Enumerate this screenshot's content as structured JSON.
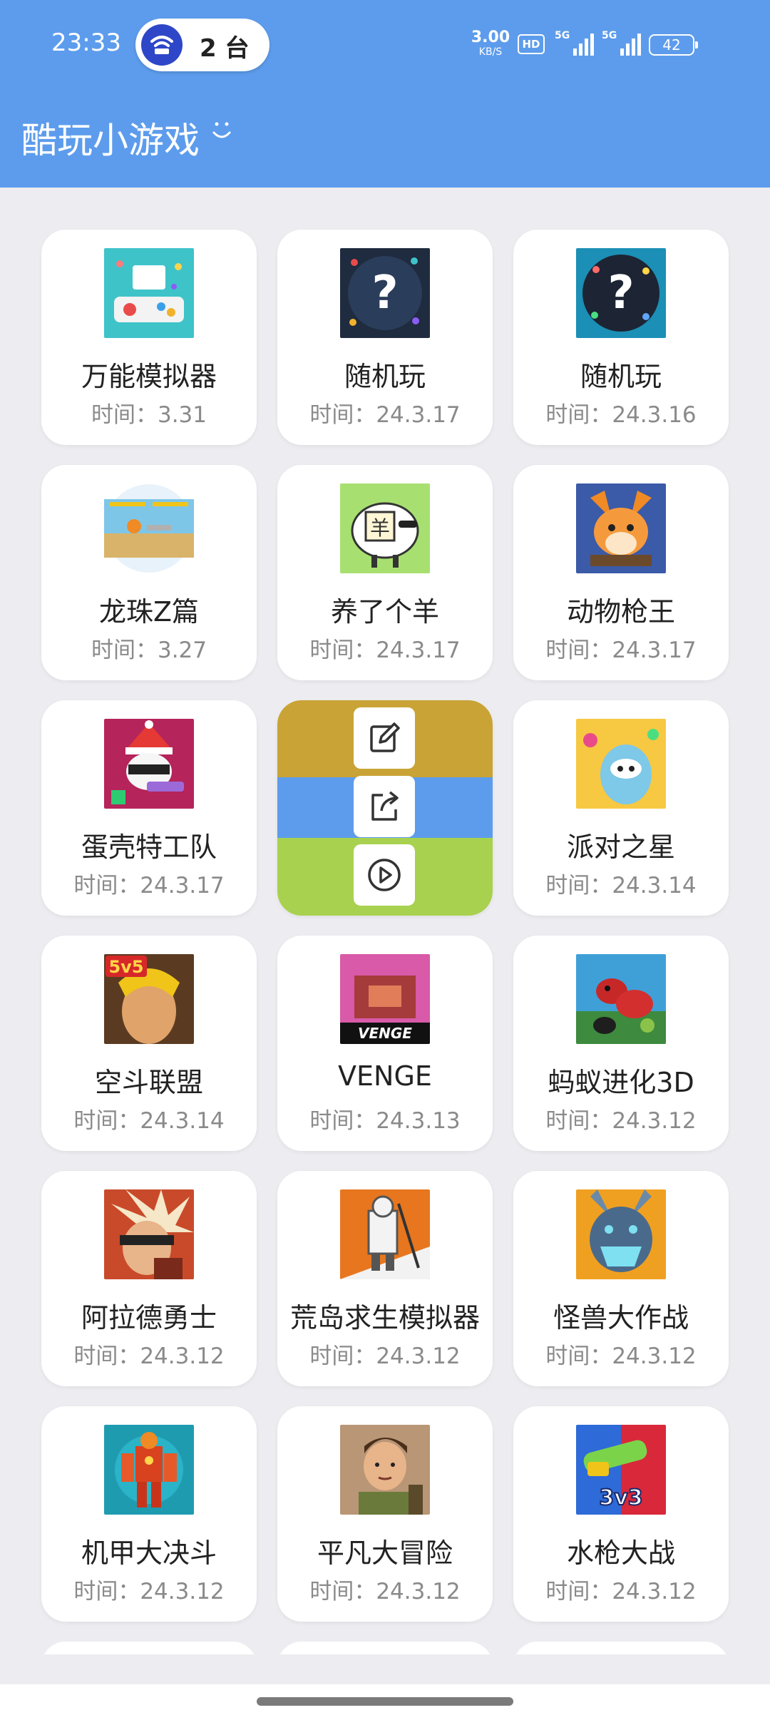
{
  "status_bar": {
    "time": "23:33",
    "hotspot_count": "2 台",
    "net_speed_value": "3.00",
    "net_speed_unit": "KB/S",
    "hd_label": "HD",
    "signal1_label": "5G",
    "signal2_label": "5G",
    "battery": "42"
  },
  "header": {
    "title": "酷玩小游戏",
    "accent_color": "#5d9cec"
  },
  "games": [
    {
      "name": "万能模拟器",
      "time_label": "时间：",
      "time": "3.31",
      "icon": "emulator-icon"
    },
    {
      "name": "随机玩",
      "time_label": "时间：",
      "time": "24.3.17",
      "icon": "random-play-icon"
    },
    {
      "name": "随机玩",
      "time_label": "时间：",
      "time": "24.3.16",
      "icon": "random-play-icon"
    },
    {
      "name": "龙珠Z篇",
      "time_label": "时间：",
      "time": "3.27",
      "icon": "dragon-ball-icon"
    },
    {
      "name": "养了个羊",
      "time_label": "时间：",
      "time": "24.3.17",
      "icon": "sheep-icon"
    },
    {
      "name": "动物枪王",
      "time_label": "时间：",
      "time": "24.3.17",
      "icon": "fox-gunner-icon"
    },
    {
      "name": "蛋壳特工队",
      "time_label": "时间：",
      "time": "24.3.17",
      "icon": "agent-icon"
    },
    {
      "name": "派对之星",
      "time_label": "时间：",
      "time": "24.3.14",
      "icon": "party-star-icon"
    },
    {
      "name": "空斗联盟",
      "time_label": "时间：",
      "time": "24.3.14",
      "icon": "5v5-icon"
    },
    {
      "name": "VENGE",
      "time_label": "时间：",
      "time": "24.3.13",
      "icon": "venge-icon"
    },
    {
      "name": "蚂蚁进化3D",
      "time_label": "时间：",
      "time": "24.3.12",
      "icon": "ant-icon"
    },
    {
      "name": "阿拉德勇士",
      "time_label": "时间：",
      "time": "24.3.12",
      "icon": "warrior-icon"
    },
    {
      "name": "荒岛求生模拟器",
      "time_label": "时间：",
      "time": "24.3.12",
      "icon": "survival-icon"
    },
    {
      "name": "怪兽大作战",
      "time_label": "时间：",
      "time": "24.3.12",
      "icon": "monster-icon"
    },
    {
      "name": "机甲大决斗",
      "time_label": "时间：",
      "time": "24.3.12",
      "icon": "mecha-icon"
    },
    {
      "name": "平凡大冒险",
      "time_label": "时间：",
      "time": "24.3.12",
      "icon": "adventure-icon"
    },
    {
      "name": "水枪大战",
      "time_label": "时间：",
      "time": "24.3.12",
      "icon": "water-gun-icon"
    }
  ],
  "action_card": {
    "colors": [
      "#c9a335",
      "#5d9cec",
      "#a8d14f"
    ],
    "actions": [
      "edit-icon",
      "share-icon",
      "play-icon"
    ]
  }
}
